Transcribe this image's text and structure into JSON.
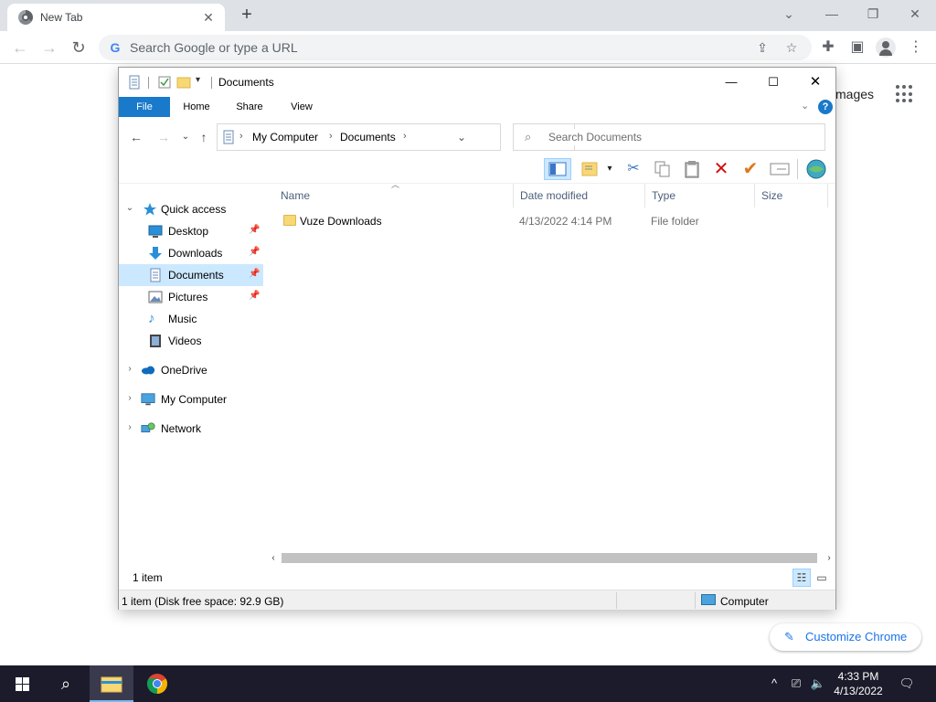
{
  "chrome": {
    "tab_title": "New Tab",
    "omnibox_placeholder": "Search Google or type a URL",
    "ntp_images": "mages",
    "customize_label": "Customize Chrome"
  },
  "explorer": {
    "title": "Documents",
    "ribbon": {
      "file": "File",
      "home": "Home",
      "share": "Share",
      "view": "View"
    },
    "breadcrumb": [
      "My Computer",
      "Documents"
    ],
    "search_placeholder": "Search Documents",
    "nav": [
      {
        "label": "Quick access",
        "icon": "star-icon"
      },
      {
        "label": "Desktop",
        "icon": "desktop-icon",
        "pinned": true
      },
      {
        "label": "Downloads",
        "icon": "download-icon",
        "pinned": true
      },
      {
        "label": "Documents",
        "icon": "document-icon",
        "pinned": true,
        "selected": true
      },
      {
        "label": "Pictures",
        "icon": "pictures-icon",
        "pinned": true
      },
      {
        "label": "Music",
        "icon": "music-icon"
      },
      {
        "label": "Videos",
        "icon": "video-icon"
      },
      {
        "label": "OneDrive",
        "icon": "cloud-icon"
      },
      {
        "label": "My Computer",
        "icon": "computer-icon"
      },
      {
        "label": "Network",
        "icon": "network-icon"
      }
    ],
    "columns": {
      "name": "Name",
      "date": "Date modified",
      "type": "Type",
      "size": "Size"
    },
    "files": [
      {
        "name": "Vuze Downloads",
        "date": "4/13/2022 4:14 PM",
        "type": "File folder",
        "size": ""
      }
    ],
    "item_count": "1 item",
    "status_text": "1 item (Disk free space: 92.9 GB)",
    "status_location": "Computer"
  },
  "taskbar": {
    "time": "4:33 PM",
    "date": "4/13/2022"
  }
}
